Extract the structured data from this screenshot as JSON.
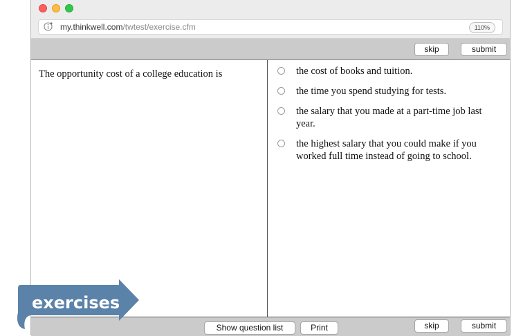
{
  "browser": {
    "url_domain": "my.thinkwell.com",
    "url_path": "/twtest/exercise.cfm",
    "zoom": "110%"
  },
  "toolbar": {
    "skip_label": "skip",
    "submit_label": "submit"
  },
  "question": {
    "text": "The opportunity cost of a college education is"
  },
  "choices": [
    {
      "text": "the cost of books and tuition."
    },
    {
      "text": "the time you spend studying for tests."
    },
    {
      "text": "the salary that you made at a part-time job last year."
    },
    {
      "text": "the highest salary that you could make if you worked full time instead of going to school."
    }
  ],
  "footer": {
    "show_question_list_label": "Show question list",
    "print_label": "Print",
    "skip_label": "skip",
    "submit_label": "submit"
  },
  "badge": {
    "label": "exercises",
    "color": "#5b82a8"
  }
}
